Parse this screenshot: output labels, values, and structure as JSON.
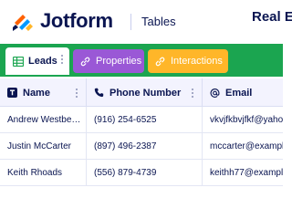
{
  "header": {
    "brand": "Jotform",
    "product": "Tables",
    "title": "Real E"
  },
  "tabs": [
    {
      "label": "Leads",
      "icon": "grid-table-icon",
      "active": true
    },
    {
      "label": "Properties",
      "icon": "link-icon",
      "color": "#9a58d6"
    },
    {
      "label": "Interactions",
      "icon": "link-icon",
      "color": "#ffb629"
    }
  ],
  "table": {
    "columns": [
      {
        "label": "Name",
        "icon": "text-type-icon"
      },
      {
        "label": "Phone Number",
        "icon": "phone-icon"
      },
      {
        "label": "Email",
        "icon": "at-sign-icon"
      }
    ],
    "rows": [
      {
        "name": "Andrew Westbe…",
        "phone": "(916) 254-6525",
        "email": "vkvjfkbvjfkf@yaho"
      },
      {
        "name": "Justin McCarter",
        "phone": "(897) 496-2387",
        "email": "mccarter@exampl"
      },
      {
        "name": "Keith Rhoads",
        "phone": "(556) 879-4739",
        "email": "keithh77@exampl"
      }
    ]
  },
  "colors": {
    "tabbar": "#1ba550",
    "properties": "#9a58d6",
    "interactions": "#ffb629",
    "text": "#0a1551"
  }
}
